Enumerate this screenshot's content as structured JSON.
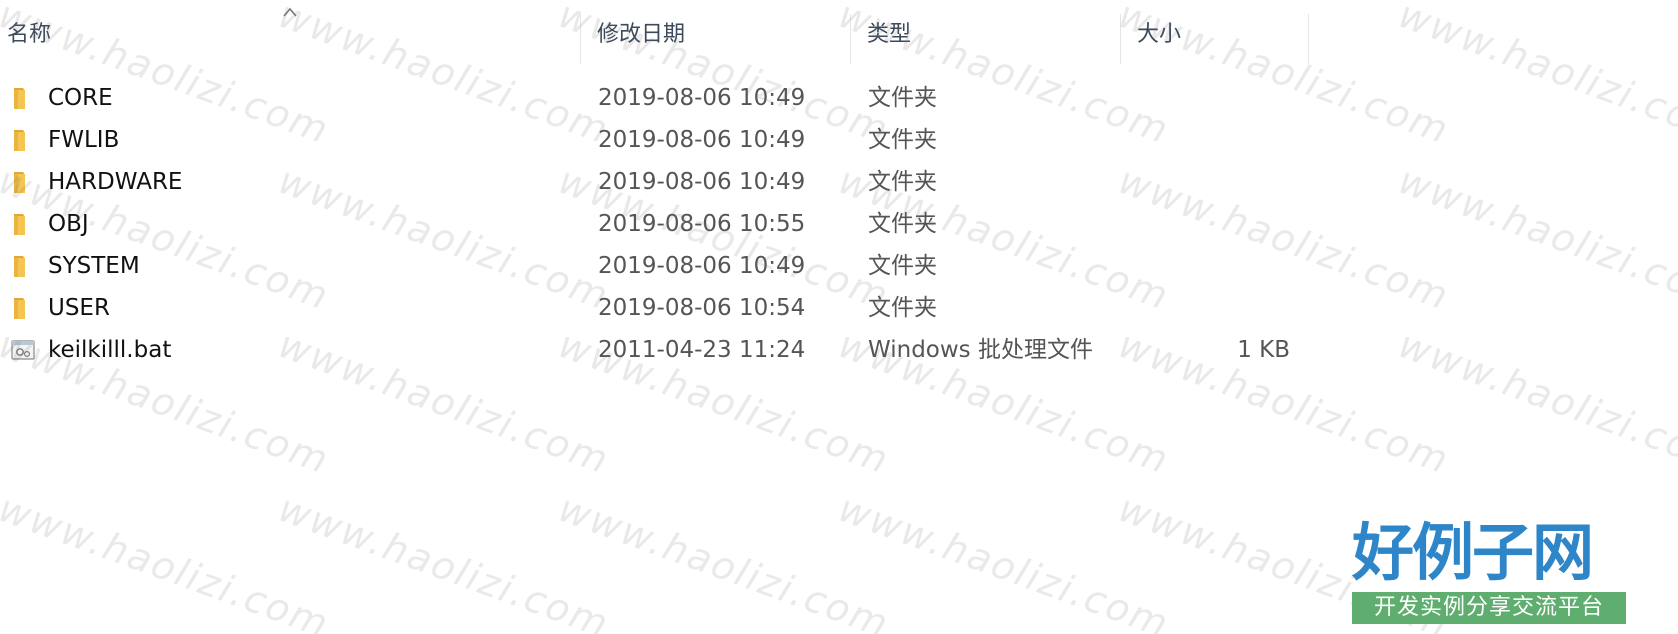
{
  "header": {
    "columns": [
      {
        "label": "名称"
      },
      {
        "label": "修改日期"
      },
      {
        "label": "类型"
      },
      {
        "label": "大小"
      }
    ],
    "sort_indicator": "chevron-up-icon"
  },
  "files": [
    {
      "name": "CORE",
      "date": "2019-08-06 10:49",
      "type": "文件夹",
      "size": "",
      "icon": "folder-icon"
    },
    {
      "name": "FWLIB",
      "date": "2019-08-06 10:49",
      "type": "文件夹",
      "size": "",
      "icon": "folder-icon"
    },
    {
      "name": "HARDWARE",
      "date": "2019-08-06 10:49",
      "type": "文件夹",
      "size": "",
      "icon": "folder-icon"
    },
    {
      "name": "OBJ",
      "date": "2019-08-06 10:55",
      "type": "文件夹",
      "size": "",
      "icon": "folder-icon"
    },
    {
      "name": "SYSTEM",
      "date": "2019-08-06 10:49",
      "type": "文件夹",
      "size": "",
      "icon": "folder-icon"
    },
    {
      "name": "USER",
      "date": "2019-08-06 10:54",
      "type": "文件夹",
      "size": "",
      "icon": "folder-icon"
    },
    {
      "name": "keilkilll.bat",
      "date": "2011-04-23 11:24",
      "type": "Windows 批处理文件",
      "size": "1 KB",
      "icon": "batch-file-icon"
    }
  ],
  "watermark": {
    "text": "www.haolizi.com"
  },
  "logo": {
    "title": "好例子网",
    "subtitle": "开发实例分享交流平台",
    "title_color": "#2e86c9",
    "bar_color": "#5fae6f"
  },
  "colors": {
    "folder": "#f5c451",
    "header_text": "#3c4a5c"
  }
}
